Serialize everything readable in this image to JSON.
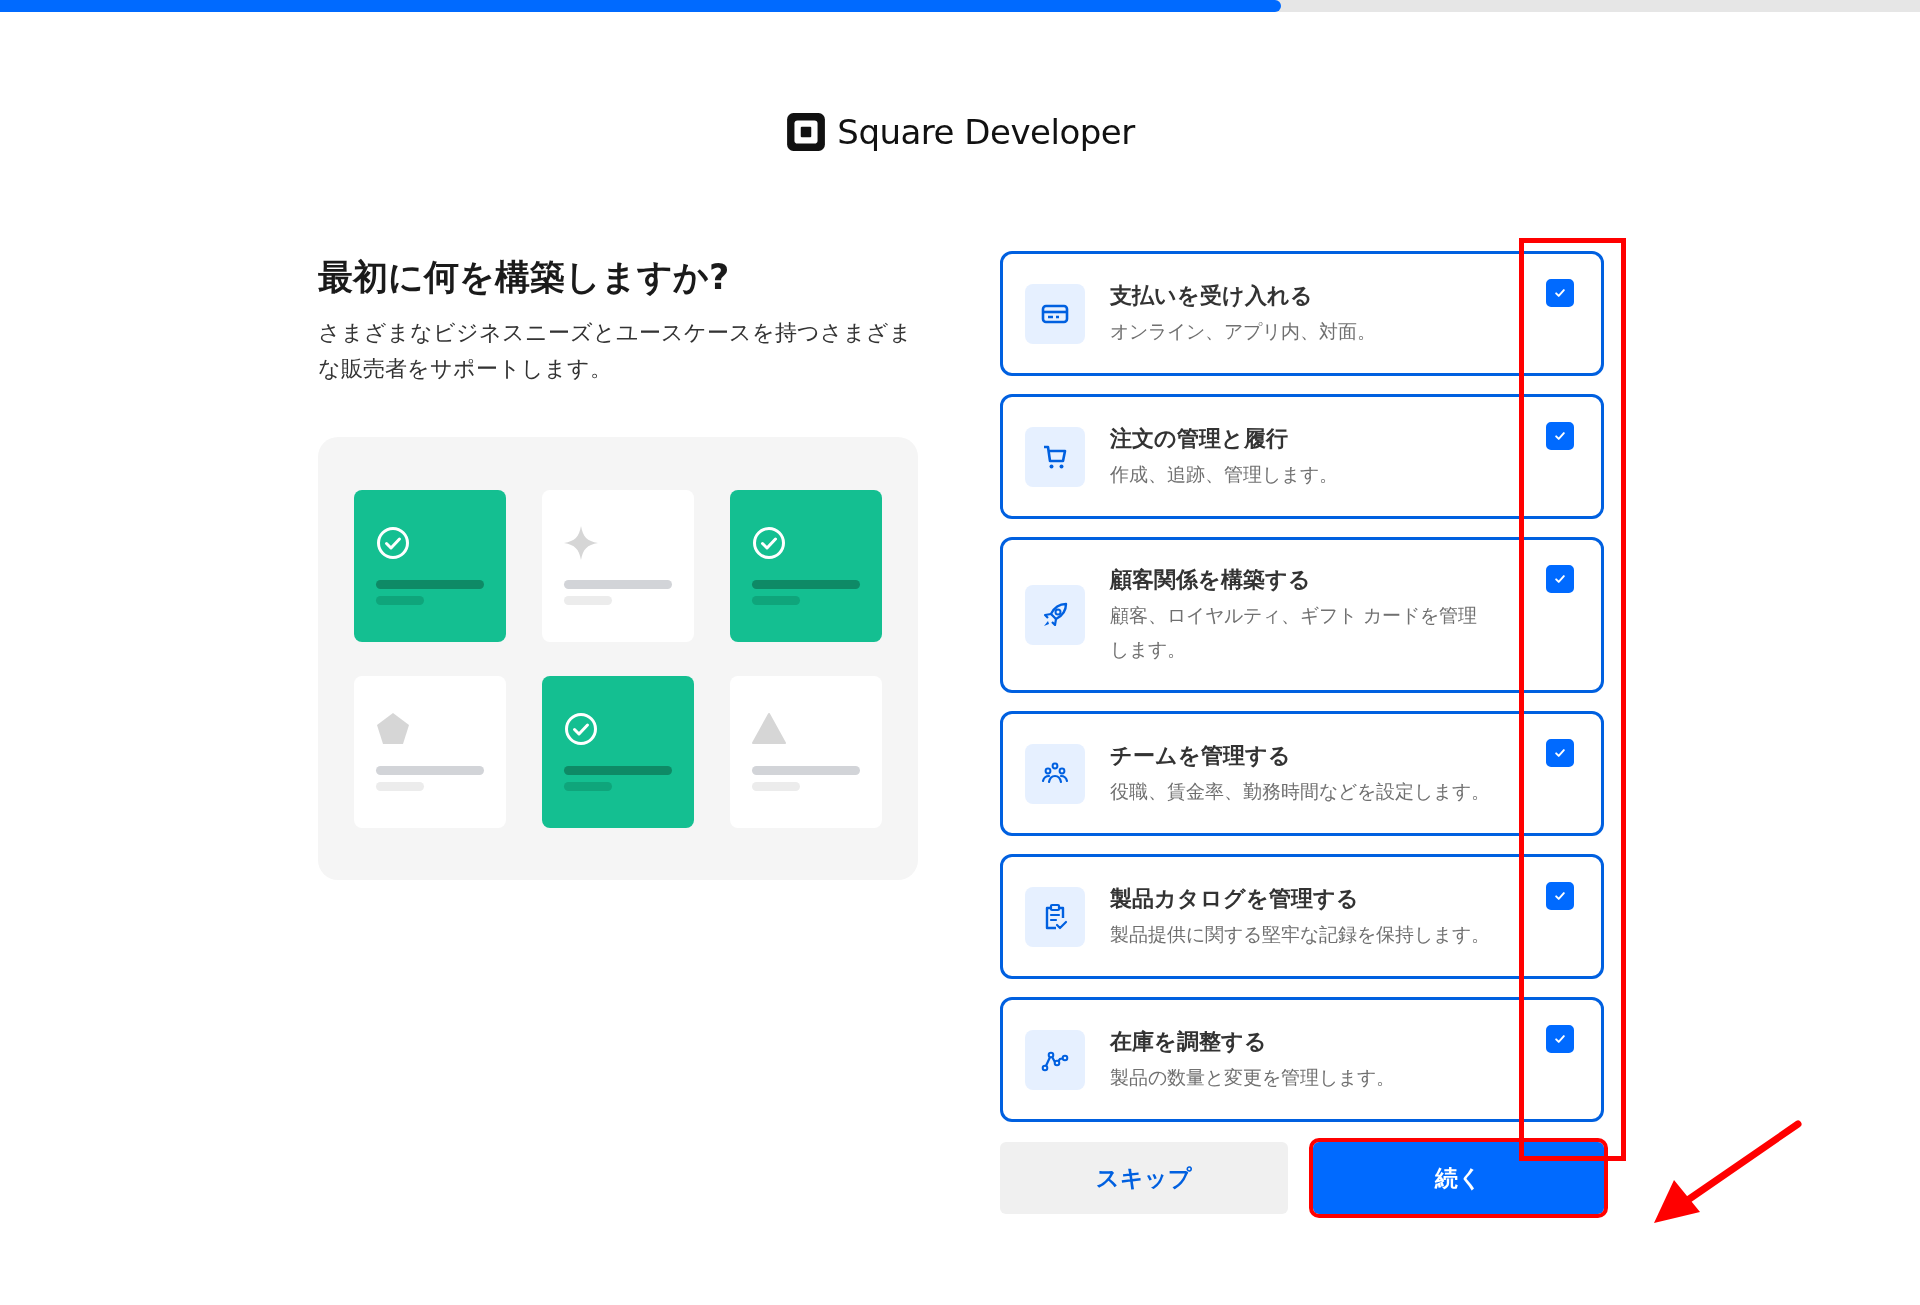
{
  "progress": {
    "level": 0.667
  },
  "logo": {
    "text": "Square Developer"
  },
  "heading": "最初に何を構築しますか?",
  "description": "さまざまなビジネスニーズとユースケースを持つさまざまな販売者をサポートします。",
  "illustration": {
    "tiles": [
      {
        "kind": "check",
        "checked": true
      },
      {
        "kind": "sparkle",
        "checked": false
      },
      {
        "kind": "check",
        "checked": true
      },
      {
        "kind": "pentagon",
        "checked": false
      },
      {
        "kind": "check",
        "checked": true
      },
      {
        "kind": "triangle",
        "checked": false
      }
    ]
  },
  "options": [
    {
      "title": "支払いを受け入れる",
      "description": "オンライン、アプリ内、対面。",
      "checked": true
    },
    {
      "title": "注文の管理と履行",
      "description": "作成、追跡、管理します。",
      "checked": true
    },
    {
      "title": "顧客関係を構築する",
      "description": "顧客、ロイヤルティ、ギフト カードを管理します。",
      "checked": true
    },
    {
      "title": "チームを管理する",
      "description": "役職、賃金率、勤務時間などを設定します。",
      "checked": true
    },
    {
      "title": "製品カタログを管理する",
      "description": "製品提供に関する堅牢な記録を保持します。",
      "checked": true
    },
    {
      "title": "在庫を調整する",
      "description": "製品の数量と変更を管理します。",
      "checked": true
    }
  ],
  "buttons": {
    "skip": "スキップ",
    "continue": "続く"
  }
}
